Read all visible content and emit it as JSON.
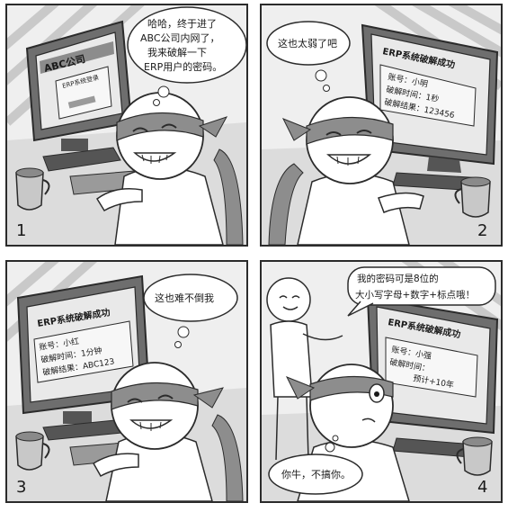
{
  "panels": [
    {
      "number": "1",
      "screen": {
        "company": "ABC公司",
        "login_title": "ERP系统登录"
      },
      "thought": [
        "哈哈，终于进了",
        "ABC公司内网了，",
        "我来破解一下",
        "ERP用户的密码。"
      ]
    },
    {
      "number": "2",
      "screen": {
        "title": "ERP系统破解成功",
        "account": "账号：小明",
        "time": "破解时间：1秒",
        "result": "破解结果：123456"
      },
      "thought": [
        "这也太弱了吧"
      ]
    },
    {
      "number": "3",
      "screen": {
        "title": "ERP系统破解成功",
        "account": "账号：小红",
        "time": "破解时间：1分钟",
        "result": "破解结果：ABC123"
      },
      "thought": [
        "这也难不倒我"
      ]
    },
    {
      "number": "4",
      "screen": {
        "title": "ERP系统破解成功",
        "account": "账号：小强",
        "time": "破解时间：",
        "result": "预计+10年"
      },
      "speech": [
        "我的密码可是8位的",
        "大小写字母+数字+标点哦！"
      ],
      "thought": [
        "你牛，不搞你。"
      ]
    }
  ]
}
